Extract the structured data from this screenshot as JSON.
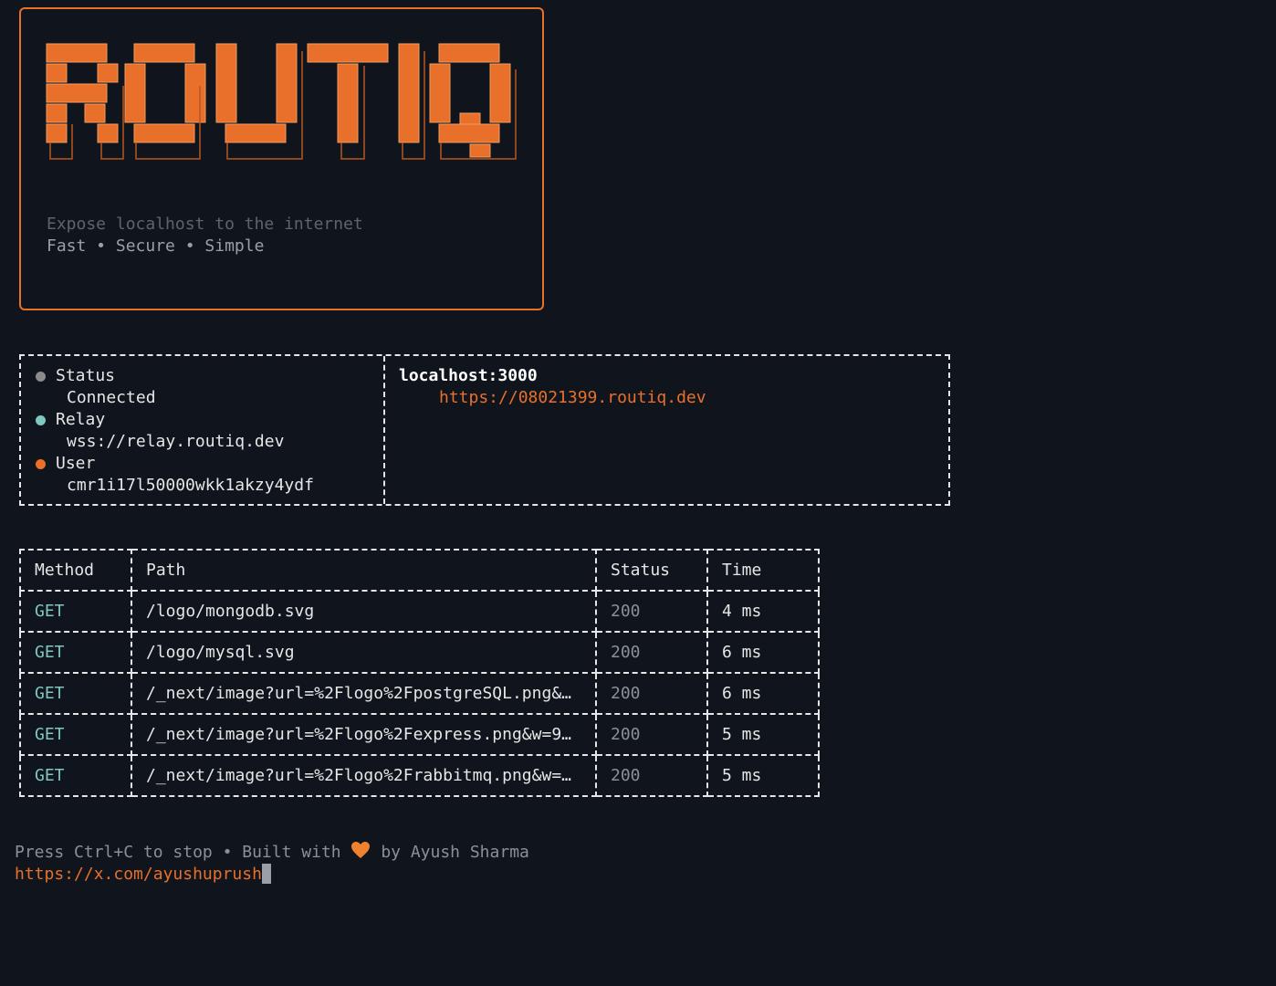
{
  "banner": {
    "logo_text": "ROUTIQ",
    "tagline": "Expose localhost to the internet",
    "features": "Fast • Secure • Simple"
  },
  "colors": {
    "accent": "#e8702a",
    "get": "#7fc7bf",
    "status_ok": "#8b9096"
  },
  "info": {
    "items": [
      {
        "label": "Status",
        "value": "Connected",
        "dot_color": "#8b8b8b",
        "icon": "status-dot-icon"
      },
      {
        "label": "Relay",
        "value": "wss://relay.routiq.dev",
        "dot_color": "#7fc7bf",
        "icon": "relay-dot-icon"
      },
      {
        "label": "User",
        "value": "cmr1i17l50000wkk1akzy4ydf",
        "dot_color": "#e8702a",
        "icon": "user-dot-icon"
      }
    ],
    "local_host": "localhost:3000",
    "public_url": "https://08021399.routiq.dev"
  },
  "requests": {
    "headers": [
      "Method",
      "Path",
      "Status",
      "Time"
    ],
    "rows": [
      {
        "method": "GET",
        "path": "/logo/mongodb.svg",
        "status": "200",
        "time": "4 ms"
      },
      {
        "method": "GET",
        "path": "/logo/mysql.svg",
        "status": "200",
        "time": "6 ms"
      },
      {
        "method": "GET",
        "path": "/_next/image?url=%2Flogo%2FpostgreSQL.png&…",
        "status": "200",
        "time": "6 ms"
      },
      {
        "method": "GET",
        "path": "/_next/image?url=%2Flogo%2Fexpress.png&w=9…",
        "status": "200",
        "time": "5 ms"
      },
      {
        "method": "GET",
        "path": "/_next/image?url=%2Flogo%2Frabbitmq.png&w=…",
        "status": "200",
        "time": "5 ms"
      }
    ]
  },
  "footer": {
    "prefix": "Press Ctrl+C to stop • Built with",
    "heart_icon": "orange-heart-icon",
    "suffix": "by Ayush Sharma",
    "link": "https://x.com/ayushuprush"
  }
}
